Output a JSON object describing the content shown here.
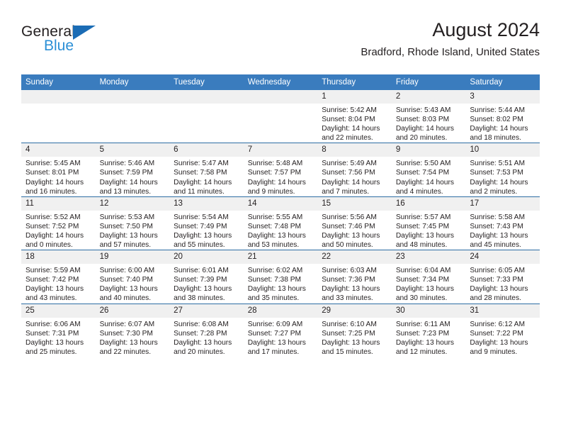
{
  "brand": {
    "line1": "General",
    "line2": "Blue",
    "logo_icon": "triangle-logo-icon"
  },
  "header": {
    "title": "August 2024",
    "subtitle": "Bradford, Rhode Island, United States"
  },
  "colors": {
    "header_blue": "#3a7cbe",
    "rule_blue": "#2e6da4",
    "brand_blue": "#2b8fd6",
    "daynum_bg": "#f0f0f0",
    "text": "#231f20"
  },
  "weekday_headers": [
    "Sunday",
    "Monday",
    "Tuesday",
    "Wednesday",
    "Thursday",
    "Friday",
    "Saturday"
  ],
  "weeks": [
    [
      {
        "day": "",
        "empty": true
      },
      {
        "day": "",
        "empty": true
      },
      {
        "day": "",
        "empty": true
      },
      {
        "day": "",
        "empty": true
      },
      {
        "day": "1",
        "sunrise": "Sunrise: 5:42 AM",
        "sunset": "Sunset: 8:04 PM",
        "daylight_l1": "Daylight: 14 hours",
        "daylight_l2": "and 22 minutes."
      },
      {
        "day": "2",
        "sunrise": "Sunrise: 5:43 AM",
        "sunset": "Sunset: 8:03 PM",
        "daylight_l1": "Daylight: 14 hours",
        "daylight_l2": "and 20 minutes."
      },
      {
        "day": "3",
        "sunrise": "Sunrise: 5:44 AM",
        "sunset": "Sunset: 8:02 PM",
        "daylight_l1": "Daylight: 14 hours",
        "daylight_l2": "and 18 minutes."
      }
    ],
    [
      {
        "day": "4",
        "sunrise": "Sunrise: 5:45 AM",
        "sunset": "Sunset: 8:01 PM",
        "daylight_l1": "Daylight: 14 hours",
        "daylight_l2": "and 16 minutes."
      },
      {
        "day": "5",
        "sunrise": "Sunrise: 5:46 AM",
        "sunset": "Sunset: 7:59 PM",
        "daylight_l1": "Daylight: 14 hours",
        "daylight_l2": "and 13 minutes."
      },
      {
        "day": "6",
        "sunrise": "Sunrise: 5:47 AM",
        "sunset": "Sunset: 7:58 PM",
        "daylight_l1": "Daylight: 14 hours",
        "daylight_l2": "and 11 minutes."
      },
      {
        "day": "7",
        "sunrise": "Sunrise: 5:48 AM",
        "sunset": "Sunset: 7:57 PM",
        "daylight_l1": "Daylight: 14 hours",
        "daylight_l2": "and 9 minutes."
      },
      {
        "day": "8",
        "sunrise": "Sunrise: 5:49 AM",
        "sunset": "Sunset: 7:56 PM",
        "daylight_l1": "Daylight: 14 hours",
        "daylight_l2": "and 7 minutes."
      },
      {
        "day": "9",
        "sunrise": "Sunrise: 5:50 AM",
        "sunset": "Sunset: 7:54 PM",
        "daylight_l1": "Daylight: 14 hours",
        "daylight_l2": "and 4 minutes."
      },
      {
        "day": "10",
        "sunrise": "Sunrise: 5:51 AM",
        "sunset": "Sunset: 7:53 PM",
        "daylight_l1": "Daylight: 14 hours",
        "daylight_l2": "and 2 minutes."
      }
    ],
    [
      {
        "day": "11",
        "sunrise": "Sunrise: 5:52 AM",
        "sunset": "Sunset: 7:52 PM",
        "daylight_l1": "Daylight: 14 hours",
        "daylight_l2": "and 0 minutes."
      },
      {
        "day": "12",
        "sunrise": "Sunrise: 5:53 AM",
        "sunset": "Sunset: 7:50 PM",
        "daylight_l1": "Daylight: 13 hours",
        "daylight_l2": "and 57 minutes."
      },
      {
        "day": "13",
        "sunrise": "Sunrise: 5:54 AM",
        "sunset": "Sunset: 7:49 PM",
        "daylight_l1": "Daylight: 13 hours",
        "daylight_l2": "and 55 minutes."
      },
      {
        "day": "14",
        "sunrise": "Sunrise: 5:55 AM",
        "sunset": "Sunset: 7:48 PM",
        "daylight_l1": "Daylight: 13 hours",
        "daylight_l2": "and 53 minutes."
      },
      {
        "day": "15",
        "sunrise": "Sunrise: 5:56 AM",
        "sunset": "Sunset: 7:46 PM",
        "daylight_l1": "Daylight: 13 hours",
        "daylight_l2": "and 50 minutes."
      },
      {
        "day": "16",
        "sunrise": "Sunrise: 5:57 AM",
        "sunset": "Sunset: 7:45 PM",
        "daylight_l1": "Daylight: 13 hours",
        "daylight_l2": "and 48 minutes."
      },
      {
        "day": "17",
        "sunrise": "Sunrise: 5:58 AM",
        "sunset": "Sunset: 7:43 PM",
        "daylight_l1": "Daylight: 13 hours",
        "daylight_l2": "and 45 minutes."
      }
    ],
    [
      {
        "day": "18",
        "sunrise": "Sunrise: 5:59 AM",
        "sunset": "Sunset: 7:42 PM",
        "daylight_l1": "Daylight: 13 hours",
        "daylight_l2": "and 43 minutes."
      },
      {
        "day": "19",
        "sunrise": "Sunrise: 6:00 AM",
        "sunset": "Sunset: 7:40 PM",
        "daylight_l1": "Daylight: 13 hours",
        "daylight_l2": "and 40 minutes."
      },
      {
        "day": "20",
        "sunrise": "Sunrise: 6:01 AM",
        "sunset": "Sunset: 7:39 PM",
        "daylight_l1": "Daylight: 13 hours",
        "daylight_l2": "and 38 minutes."
      },
      {
        "day": "21",
        "sunrise": "Sunrise: 6:02 AM",
        "sunset": "Sunset: 7:38 PM",
        "daylight_l1": "Daylight: 13 hours",
        "daylight_l2": "and 35 minutes."
      },
      {
        "day": "22",
        "sunrise": "Sunrise: 6:03 AM",
        "sunset": "Sunset: 7:36 PM",
        "daylight_l1": "Daylight: 13 hours",
        "daylight_l2": "and 33 minutes."
      },
      {
        "day": "23",
        "sunrise": "Sunrise: 6:04 AM",
        "sunset": "Sunset: 7:34 PM",
        "daylight_l1": "Daylight: 13 hours",
        "daylight_l2": "and 30 minutes."
      },
      {
        "day": "24",
        "sunrise": "Sunrise: 6:05 AM",
        "sunset": "Sunset: 7:33 PM",
        "daylight_l1": "Daylight: 13 hours",
        "daylight_l2": "and 28 minutes."
      }
    ],
    [
      {
        "day": "25",
        "sunrise": "Sunrise: 6:06 AM",
        "sunset": "Sunset: 7:31 PM",
        "daylight_l1": "Daylight: 13 hours",
        "daylight_l2": "and 25 minutes."
      },
      {
        "day": "26",
        "sunrise": "Sunrise: 6:07 AM",
        "sunset": "Sunset: 7:30 PM",
        "daylight_l1": "Daylight: 13 hours",
        "daylight_l2": "and 22 minutes."
      },
      {
        "day": "27",
        "sunrise": "Sunrise: 6:08 AM",
        "sunset": "Sunset: 7:28 PM",
        "daylight_l1": "Daylight: 13 hours",
        "daylight_l2": "and 20 minutes."
      },
      {
        "day": "28",
        "sunrise": "Sunrise: 6:09 AM",
        "sunset": "Sunset: 7:27 PM",
        "daylight_l1": "Daylight: 13 hours",
        "daylight_l2": "and 17 minutes."
      },
      {
        "day": "29",
        "sunrise": "Sunrise: 6:10 AM",
        "sunset": "Sunset: 7:25 PM",
        "daylight_l1": "Daylight: 13 hours",
        "daylight_l2": "and 15 minutes."
      },
      {
        "day": "30",
        "sunrise": "Sunrise: 6:11 AM",
        "sunset": "Sunset: 7:23 PM",
        "daylight_l1": "Daylight: 13 hours",
        "daylight_l2": "and 12 minutes."
      },
      {
        "day": "31",
        "sunrise": "Sunrise: 6:12 AM",
        "sunset": "Sunset: 7:22 PM",
        "daylight_l1": "Daylight: 13 hours",
        "daylight_l2": "and 9 minutes."
      }
    ]
  ]
}
